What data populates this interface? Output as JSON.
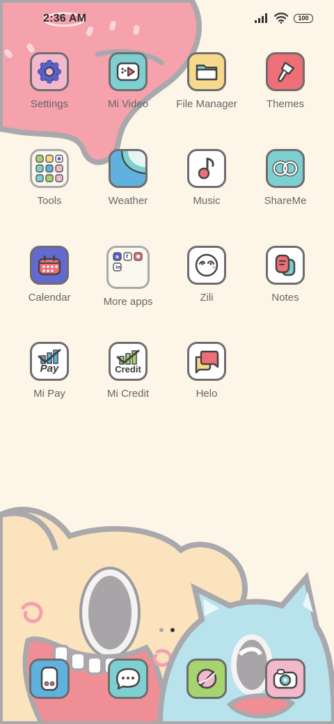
{
  "status_bar": {
    "time": "2:36 AM",
    "battery_level": "100",
    "icons": [
      "signal-icon",
      "wifi-icon",
      "battery-icon"
    ]
  },
  "apps": [
    {
      "label": "Settings",
      "icon": "settings-icon",
      "color": "#f4b8cc"
    },
    {
      "label": "Mi Video",
      "icon": "video-icon",
      "color": "#7ecfd0"
    },
    {
      "label": "File Manager",
      "icon": "folder-icon",
      "color": "#f7d98c"
    },
    {
      "label": "Themes",
      "icon": "brush-icon",
      "color": "#ef6f76"
    },
    {
      "label": "Tools",
      "icon": "tools-folder-icon",
      "color": "#fbf8ef"
    },
    {
      "label": "Weather",
      "icon": "weather-icon",
      "color": "#5fb2de"
    },
    {
      "label": "Music",
      "icon": "music-icon",
      "color": "#ffffff"
    },
    {
      "label": "ShareMe",
      "icon": "shareme-icon",
      "color": "#7ecfd0"
    },
    {
      "label": "Calendar",
      "icon": "calendar-icon",
      "color": "#6269cf"
    },
    {
      "label": "More apps",
      "icon": "more-apps-folder-icon",
      "color": "#fbf8ef"
    },
    {
      "label": "Zili",
      "icon": "zili-face-icon",
      "color": "#ffffff"
    },
    {
      "label": "Notes",
      "icon": "notes-icon",
      "color": "#ffffff"
    },
    {
      "label": "Mi Pay",
      "icon": "mi-pay-icon",
      "color": "#ffffff",
      "text": "Pay"
    },
    {
      "label": "Mi Credit",
      "icon": "mi-credit-icon",
      "color": "#ffffff",
      "text": "Credit"
    },
    {
      "label": "Helo",
      "icon": "helo-icon",
      "color": "#ffffff"
    }
  ],
  "dock": [
    {
      "icon": "phone-icon",
      "color": "#5fb2de"
    },
    {
      "icon": "messages-icon",
      "color": "#7ecfd0"
    },
    {
      "icon": "browser-icon",
      "color": "#a6d46e"
    },
    {
      "icon": "camera-icon",
      "color": "#f4b8cc"
    }
  ],
  "page_indicator": {
    "pages": 2,
    "current": 2
  }
}
